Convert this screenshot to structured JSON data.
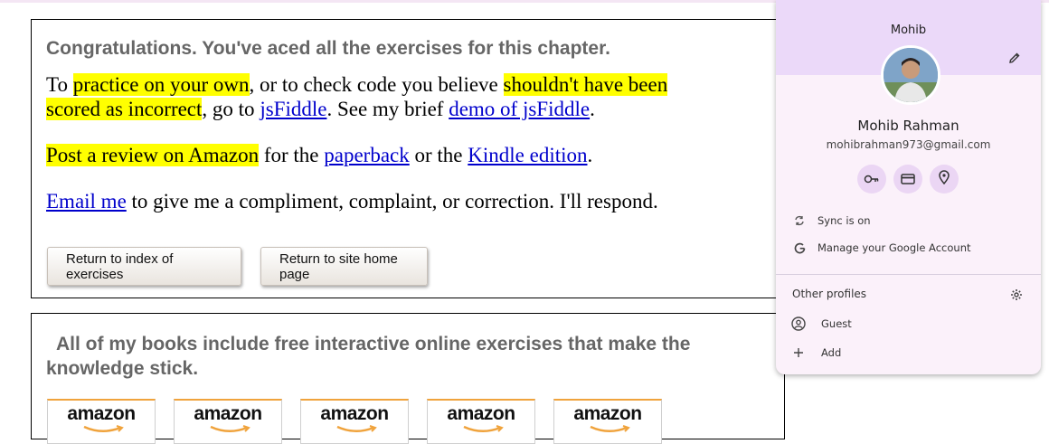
{
  "exercise_box": {
    "heading": "Congratulations. You've aced all the exercises for this chapter.",
    "p1": {
      "t1": "To ",
      "hl1": "practice on your own",
      "t2": ", or to check code you believe ",
      "hl2a": "shouldn't have been",
      "hl2b": "scored as incorrect",
      "t3": ", go to ",
      "link1": "jsFiddle",
      "t4": ". See my brief ",
      "link2": "demo of jsFiddle",
      "t5": "."
    },
    "p2": {
      "hl": "Post a review on Amazon",
      "t1": " for the ",
      "link1": "paperback",
      "t2": " or the ",
      "link2": "Kindle edition",
      "t3": "."
    },
    "p3": {
      "link": "Email me",
      "t1": " to give me a compliment, complaint, or correction. I'll respond."
    },
    "buttons": {
      "index": "Return to index of exercises",
      "home": "Return to site home page"
    }
  },
  "books_box": {
    "heading": "All of my books include free interactive online exercises that make the knowledge stick.",
    "amazon_logos": [
      "amazon",
      "amazon",
      "amazon",
      "amazon",
      "amazon"
    ]
  },
  "profile_menu": {
    "profile_label": "Mohib",
    "full_name": "Mohib Rahman",
    "email": "mohibrahman973@gmail.com",
    "sync": "Sync is on",
    "manage": "Manage your Google Account",
    "other_profiles": "Other profiles",
    "guest": "Guest",
    "add": "Add",
    "icons": {
      "edit": "pencil-icon",
      "passwords": "key-icon",
      "payments": "credit-card-icon",
      "addresses": "location-pin-icon",
      "sync": "sync-icon",
      "google": "google-icon",
      "settings": "gear-icon",
      "guest": "person-circle-icon",
      "add": "plus-icon"
    },
    "colors": {
      "header_bg": "#ebd9f9",
      "panel_bg": "#fbf1fa",
      "circle_bg": "#ebd6f4"
    }
  },
  "colors": {
    "highlight": "#ffff00",
    "link": "#0000cc",
    "heading": "#666666",
    "amazon_orange": "#f0a33c"
  }
}
